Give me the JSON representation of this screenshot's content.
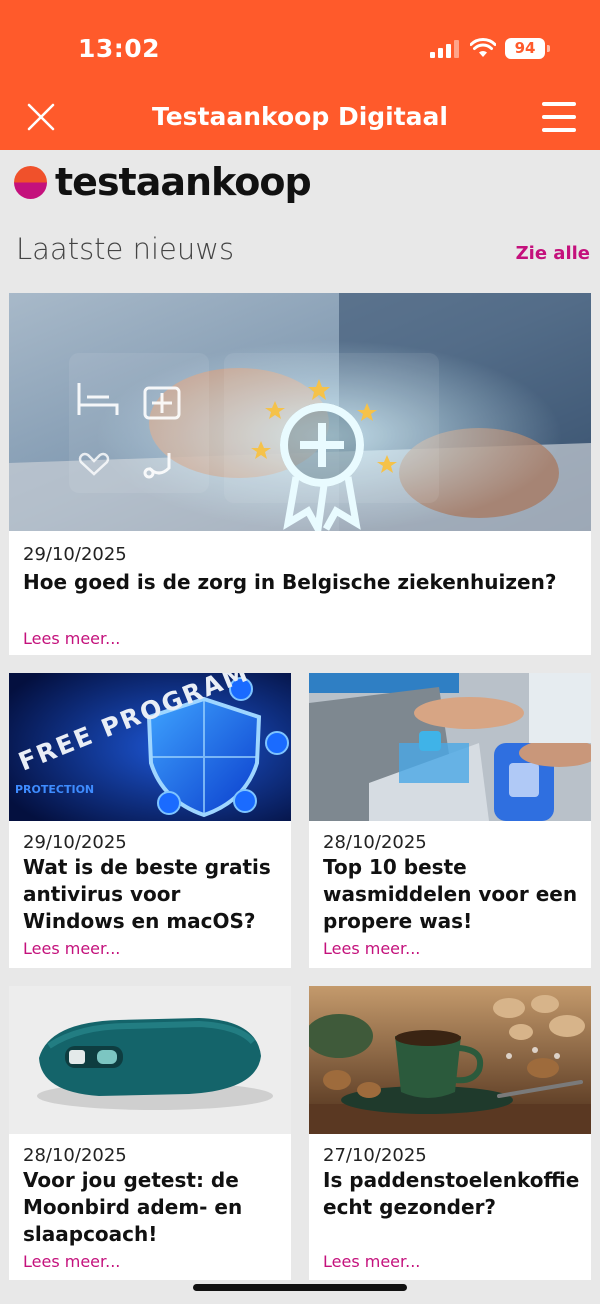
{
  "status_bar": {
    "time": "13:02",
    "battery": "94"
  },
  "header": {
    "title": "Testaankoop Digitaal",
    "close_icon": "close-icon",
    "menu_icon": "hamburger-menu-icon"
  },
  "brand": {
    "logo_text": "testaankoop",
    "accent": "#ff5a2b",
    "brand_pink": "#c4117c"
  },
  "news": {
    "section_title": "Laatste nieuws",
    "see_all": "Zie alle",
    "read_more": "Lees meer...",
    "articles": [
      {
        "date": "29/10/2025",
        "title": "Hoe goed is de zorg in Belgische ziekenhuizen?",
        "image": "hospital-care-award-image"
      },
      {
        "date": "29/10/2025",
        "title": "Wat is de beste gratis antivirus voor Windows en macOS?",
        "image": "free-antivirus-shield-image",
        "image_text": [
          "FREE PROGRAM",
          "PROTECTION"
        ]
      },
      {
        "date": "28/10/2025",
        "title": "Top 10 beste wasmiddelen voor een propere was!",
        "image": "laundry-detergent-image"
      },
      {
        "date": "28/10/2025",
        "title": "Voor jou getest: de Moonbird adem- en slaapcoach!",
        "image": "moonbird-device-image"
      },
      {
        "date": "27/10/2025",
        "title": "Is paddenstoelenkoffie echt gezonder?",
        "image": "mushroom-coffee-image"
      }
    ]
  }
}
